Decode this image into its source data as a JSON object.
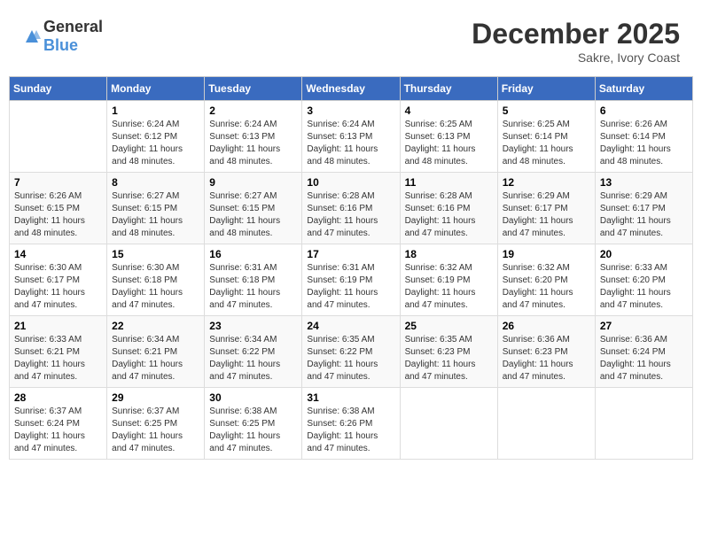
{
  "header": {
    "logo_general": "General",
    "logo_blue": "Blue",
    "month": "December 2025",
    "location": "Sakre, Ivory Coast"
  },
  "weekdays": [
    "Sunday",
    "Monday",
    "Tuesday",
    "Wednesday",
    "Thursday",
    "Friday",
    "Saturday"
  ],
  "weeks": [
    [
      {
        "day": "",
        "sunrise": "",
        "sunset": "",
        "daylight": ""
      },
      {
        "day": "1",
        "sunrise": "Sunrise: 6:24 AM",
        "sunset": "Sunset: 6:12 PM",
        "daylight": "Daylight: 11 hours and 48 minutes."
      },
      {
        "day": "2",
        "sunrise": "Sunrise: 6:24 AM",
        "sunset": "Sunset: 6:13 PM",
        "daylight": "Daylight: 11 hours and 48 minutes."
      },
      {
        "day": "3",
        "sunrise": "Sunrise: 6:24 AM",
        "sunset": "Sunset: 6:13 PM",
        "daylight": "Daylight: 11 hours and 48 minutes."
      },
      {
        "day": "4",
        "sunrise": "Sunrise: 6:25 AM",
        "sunset": "Sunset: 6:13 PM",
        "daylight": "Daylight: 11 hours and 48 minutes."
      },
      {
        "day": "5",
        "sunrise": "Sunrise: 6:25 AM",
        "sunset": "Sunset: 6:14 PM",
        "daylight": "Daylight: 11 hours and 48 minutes."
      },
      {
        "day": "6",
        "sunrise": "Sunrise: 6:26 AM",
        "sunset": "Sunset: 6:14 PM",
        "daylight": "Daylight: 11 hours and 48 minutes."
      }
    ],
    [
      {
        "day": "7",
        "sunrise": "Sunrise: 6:26 AM",
        "sunset": "Sunset: 6:15 PM",
        "daylight": "Daylight: 11 hours and 48 minutes."
      },
      {
        "day": "8",
        "sunrise": "Sunrise: 6:27 AM",
        "sunset": "Sunset: 6:15 PM",
        "daylight": "Daylight: 11 hours and 48 minutes."
      },
      {
        "day": "9",
        "sunrise": "Sunrise: 6:27 AM",
        "sunset": "Sunset: 6:15 PM",
        "daylight": "Daylight: 11 hours and 48 minutes."
      },
      {
        "day": "10",
        "sunrise": "Sunrise: 6:28 AM",
        "sunset": "Sunset: 6:16 PM",
        "daylight": "Daylight: 11 hours and 47 minutes."
      },
      {
        "day": "11",
        "sunrise": "Sunrise: 6:28 AM",
        "sunset": "Sunset: 6:16 PM",
        "daylight": "Daylight: 11 hours and 47 minutes."
      },
      {
        "day": "12",
        "sunrise": "Sunrise: 6:29 AM",
        "sunset": "Sunset: 6:17 PM",
        "daylight": "Daylight: 11 hours and 47 minutes."
      },
      {
        "day": "13",
        "sunrise": "Sunrise: 6:29 AM",
        "sunset": "Sunset: 6:17 PM",
        "daylight": "Daylight: 11 hours and 47 minutes."
      }
    ],
    [
      {
        "day": "14",
        "sunrise": "Sunrise: 6:30 AM",
        "sunset": "Sunset: 6:17 PM",
        "daylight": "Daylight: 11 hours and 47 minutes."
      },
      {
        "day": "15",
        "sunrise": "Sunrise: 6:30 AM",
        "sunset": "Sunset: 6:18 PM",
        "daylight": "Daylight: 11 hours and 47 minutes."
      },
      {
        "day": "16",
        "sunrise": "Sunrise: 6:31 AM",
        "sunset": "Sunset: 6:18 PM",
        "daylight": "Daylight: 11 hours and 47 minutes."
      },
      {
        "day": "17",
        "sunrise": "Sunrise: 6:31 AM",
        "sunset": "Sunset: 6:19 PM",
        "daylight": "Daylight: 11 hours and 47 minutes."
      },
      {
        "day": "18",
        "sunrise": "Sunrise: 6:32 AM",
        "sunset": "Sunset: 6:19 PM",
        "daylight": "Daylight: 11 hours and 47 minutes."
      },
      {
        "day": "19",
        "sunrise": "Sunrise: 6:32 AM",
        "sunset": "Sunset: 6:20 PM",
        "daylight": "Daylight: 11 hours and 47 minutes."
      },
      {
        "day": "20",
        "sunrise": "Sunrise: 6:33 AM",
        "sunset": "Sunset: 6:20 PM",
        "daylight": "Daylight: 11 hours and 47 minutes."
      }
    ],
    [
      {
        "day": "21",
        "sunrise": "Sunrise: 6:33 AM",
        "sunset": "Sunset: 6:21 PM",
        "daylight": "Daylight: 11 hours and 47 minutes."
      },
      {
        "day": "22",
        "sunrise": "Sunrise: 6:34 AM",
        "sunset": "Sunset: 6:21 PM",
        "daylight": "Daylight: 11 hours and 47 minutes."
      },
      {
        "day": "23",
        "sunrise": "Sunrise: 6:34 AM",
        "sunset": "Sunset: 6:22 PM",
        "daylight": "Daylight: 11 hours and 47 minutes."
      },
      {
        "day": "24",
        "sunrise": "Sunrise: 6:35 AM",
        "sunset": "Sunset: 6:22 PM",
        "daylight": "Daylight: 11 hours and 47 minutes."
      },
      {
        "day": "25",
        "sunrise": "Sunrise: 6:35 AM",
        "sunset": "Sunset: 6:23 PM",
        "daylight": "Daylight: 11 hours and 47 minutes."
      },
      {
        "day": "26",
        "sunrise": "Sunrise: 6:36 AM",
        "sunset": "Sunset: 6:23 PM",
        "daylight": "Daylight: 11 hours and 47 minutes."
      },
      {
        "day": "27",
        "sunrise": "Sunrise: 6:36 AM",
        "sunset": "Sunset: 6:24 PM",
        "daylight": "Daylight: 11 hours and 47 minutes."
      }
    ],
    [
      {
        "day": "28",
        "sunrise": "Sunrise: 6:37 AM",
        "sunset": "Sunset: 6:24 PM",
        "daylight": "Daylight: 11 hours and 47 minutes."
      },
      {
        "day": "29",
        "sunrise": "Sunrise: 6:37 AM",
        "sunset": "Sunset: 6:25 PM",
        "daylight": "Daylight: 11 hours and 47 minutes."
      },
      {
        "day": "30",
        "sunrise": "Sunrise: 6:38 AM",
        "sunset": "Sunset: 6:25 PM",
        "daylight": "Daylight: 11 hours and 47 minutes."
      },
      {
        "day": "31",
        "sunrise": "Sunrise: 6:38 AM",
        "sunset": "Sunset: 6:26 PM",
        "daylight": "Daylight: 11 hours and 47 minutes."
      },
      {
        "day": "",
        "sunrise": "",
        "sunset": "",
        "daylight": ""
      },
      {
        "day": "",
        "sunrise": "",
        "sunset": "",
        "daylight": ""
      },
      {
        "day": "",
        "sunrise": "",
        "sunset": "",
        "daylight": ""
      }
    ]
  ]
}
